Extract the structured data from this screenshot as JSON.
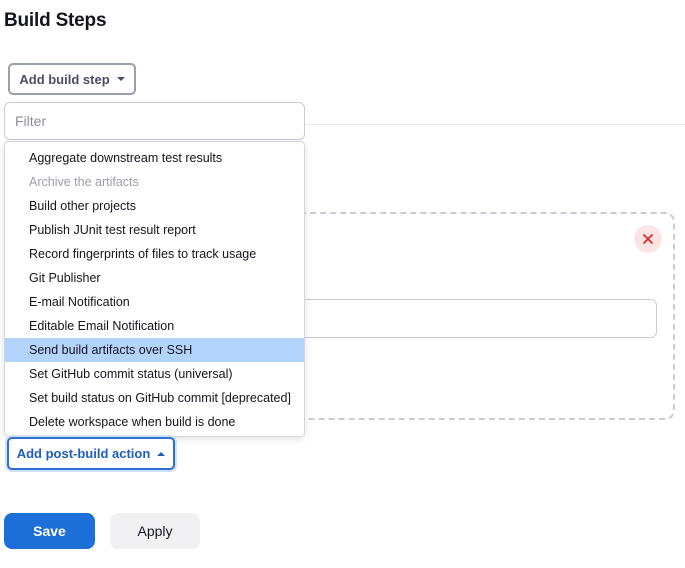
{
  "build_steps": {
    "title": "Build Steps",
    "add_button_label": "Add build step"
  },
  "filter": {
    "placeholder": "Filter",
    "value": ""
  },
  "dropdown": {
    "items": [
      {
        "label": "Aggregate downstream test results",
        "state": "normal"
      },
      {
        "label": "Archive the artifacts",
        "state": "disabled"
      },
      {
        "label": "Build other projects",
        "state": "normal"
      },
      {
        "label": "Publish JUnit test result report",
        "state": "normal"
      },
      {
        "label": "Record fingerprints of files to track usage",
        "state": "normal"
      },
      {
        "label": "Git Publisher",
        "state": "normal"
      },
      {
        "label": "E-mail Notification",
        "state": "normal"
      },
      {
        "label": "Editable Email Notification",
        "state": "normal"
      },
      {
        "label": "Send build artifacts over SSH",
        "state": "selected"
      },
      {
        "label": "Set GitHub commit status (universal)",
        "state": "normal"
      },
      {
        "label": "Set build status on GitHub commit [deprecated]",
        "state": "normal"
      },
      {
        "label": "Delete workspace when build is done",
        "state": "normal"
      }
    ]
  },
  "post_build": {
    "add_button_label": "Add post-build action"
  },
  "footer": {
    "save_label": "Save",
    "apply_label": "Apply"
  },
  "icons": {
    "close": "close-icon",
    "add_step_caret": "chevron-down-icon",
    "post_action_caret": "chevron-up-icon"
  },
  "colors": {
    "primary": "#1b6fd6",
    "selected_item": "#b3d4fd",
    "danger": "#e02a2a"
  }
}
